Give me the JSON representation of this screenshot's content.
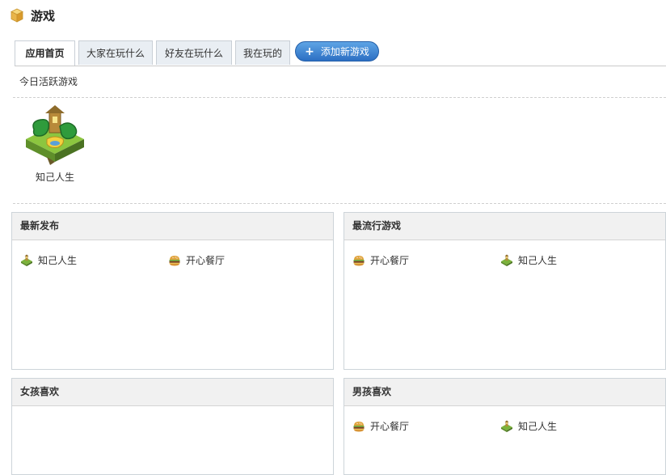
{
  "page": {
    "title": "游戏",
    "title_icon": "box-icon"
  },
  "tabs": [
    {
      "label": "应用首页",
      "active": true
    },
    {
      "label": "大家在玩什么",
      "active": false
    },
    {
      "label": "好友在玩什么",
      "active": false
    },
    {
      "label": "我在玩的",
      "active": false
    }
  ],
  "add_button": {
    "label": "添加新游戏",
    "icon": "plus-icon"
  },
  "today_section": {
    "label": "今日活跃游戏"
  },
  "featured_game": {
    "name": "知己人生",
    "icon": "zhiji-game-icon"
  },
  "panels": {
    "latest": {
      "title": "最新发布",
      "items": [
        {
          "name": "知己人生",
          "icon": "zhiji-icon"
        },
        {
          "name": "开心餐厅",
          "icon": "burger-icon"
        }
      ]
    },
    "popular": {
      "title": "最流行游戏",
      "items": [
        {
          "name": "开心餐厅",
          "icon": "burger-icon"
        },
        {
          "name": "知己人生",
          "icon": "zhiji-icon"
        }
      ]
    },
    "girls": {
      "title": "女孩喜欢",
      "items": []
    },
    "boys": {
      "title": "男孩喜欢",
      "items": [
        {
          "name": "开心餐厅",
          "icon": "burger-icon"
        },
        {
          "name": "知己人生",
          "icon": "zhiji-icon"
        }
      ]
    }
  },
  "colors": {
    "accent_button": "#2c6fc3",
    "panel_header_bg": "#f1f1f1",
    "tab_bg": "#e9eef3"
  }
}
